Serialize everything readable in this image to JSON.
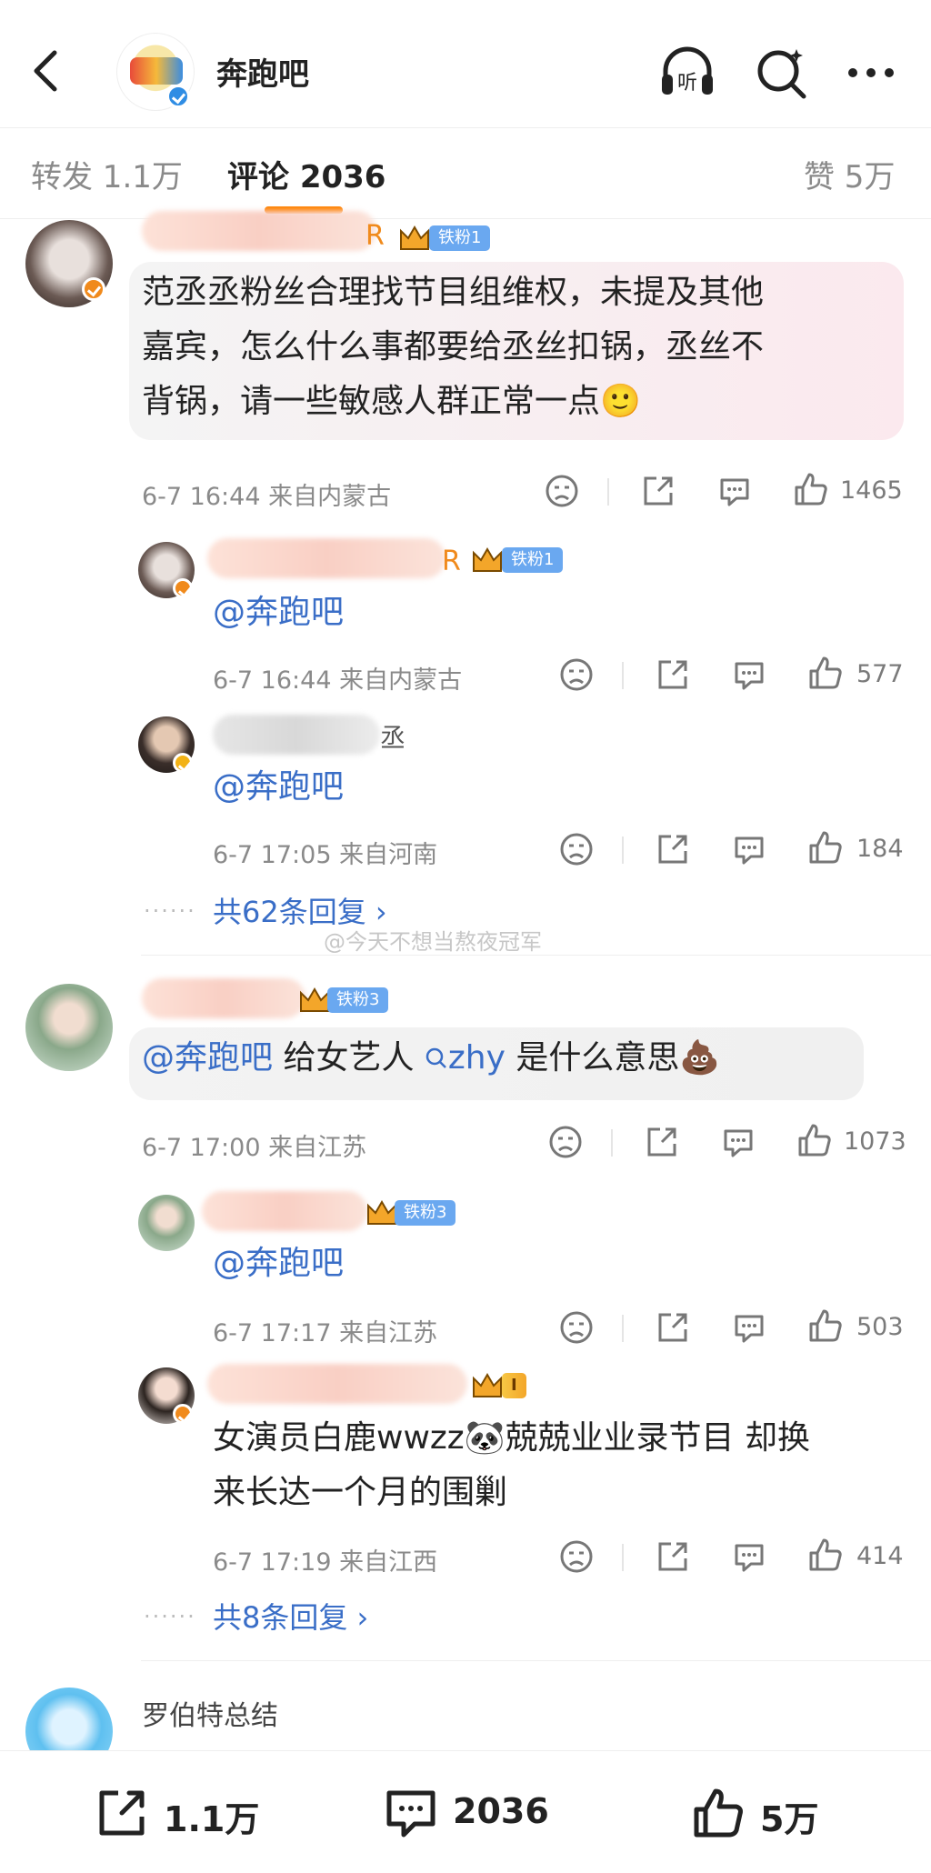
{
  "header": {
    "title": "奔跑吧",
    "icons": [
      "back-icon",
      "listen-icon",
      "search-icon",
      "more-icon"
    ],
    "listen_label": "听"
  },
  "tabs": [
    {
      "label": "转发 1.1万"
    },
    {
      "label": "评论 2036",
      "active": true
    },
    {
      "label": "赞 5万"
    }
  ],
  "watermark": "@今天不想当熬夜冠军",
  "comments": [
    {
      "name_visible": "R",
      "fan_badge": "铁粉1",
      "text": "范丞丞粉丝合理找节目组维权，未提及其他嘉宾，怎么什么事都要给丞丝扣锅，丞丝不背锅，请一些敏感人群正常一点🙂",
      "line1": "范丞丞粉丝合理找节目组维权，未提及其他",
      "line2": "嘉宾，怎么什么事都要给丞丝扣锅，丞丝不",
      "line3": "背锅，请一些敏感人群正常一点🙂",
      "meta": "6-7 16:44  来自内蒙古",
      "likes": "1465",
      "replies": [
        {
          "name_visible": "R",
          "fan_badge": "铁粉1",
          "text": "@奔跑吧",
          "meta": "6-7 16:44  来自内蒙古",
          "likes": "577"
        },
        {
          "name_visible": "丞",
          "text": "@奔跑吧",
          "meta": "6-7 17:05  来自河南",
          "likes": "184"
        }
      ],
      "more_replies": "共62条回复 ›"
    },
    {
      "fan_badge": "铁粉3",
      "text_at": "@奔跑吧",
      "text_mid": " 给女艺人 ",
      "text_search": "zhy",
      "text_end": " 是什么意思💩",
      "meta": "6-7 17:00  来自江苏",
      "likes": "1073",
      "replies": [
        {
          "fan_badge": "铁粉3",
          "text": "@奔跑吧",
          "meta": "6-7 17:17  来自江苏",
          "likes": "503"
        },
        {
          "fan_badge": "I",
          "line1": "女演员白鹿wwzz🐼兢兢业业录节目 却换",
          "line2": "来长达一个月的围剿",
          "meta": "6-7 17:19  来自江西",
          "likes": "414"
        }
      ],
      "more_replies": "共8条回复 ›"
    },
    {
      "name_visible": "罗伯特总结"
    }
  ],
  "bottom_bar": {
    "repost": "1.1万",
    "comment": "2036",
    "like": "5万"
  },
  "colors": {
    "accent": "#ff8200",
    "link": "#3a6ec7",
    "name": "#f08a1c"
  }
}
